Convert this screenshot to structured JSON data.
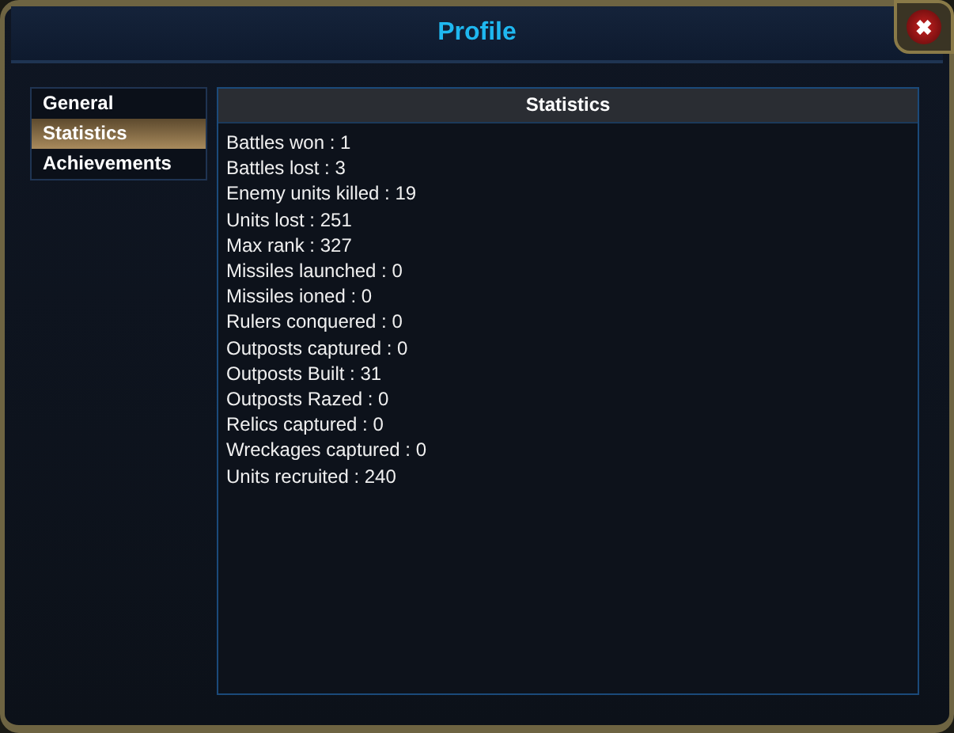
{
  "window": {
    "title": "Profile"
  },
  "close_button": {
    "label": "✖"
  },
  "sidebar": {
    "items": [
      {
        "label": "General",
        "selected": false
      },
      {
        "label": "Statistics",
        "selected": true
      },
      {
        "label": "Achievements",
        "selected": false
      }
    ]
  },
  "panel": {
    "title": "Statistics",
    "lines": [
      "Battles won : 1",
      "Battles lost : 3",
      "Enemy units killed : 19",
      "Units lost : 251",
      "Max rank : 327",
      "Missiles launched : 0",
      "Missiles ioned : 0",
      "Rulers conquered : 0",
      "Outposts captured : 0",
      "Outposts Built : 31",
      "Outposts Razed : 0",
      "Relics captured : 0",
      "Wreckages captured : 0",
      "Units recruited : 240"
    ]
  }
}
